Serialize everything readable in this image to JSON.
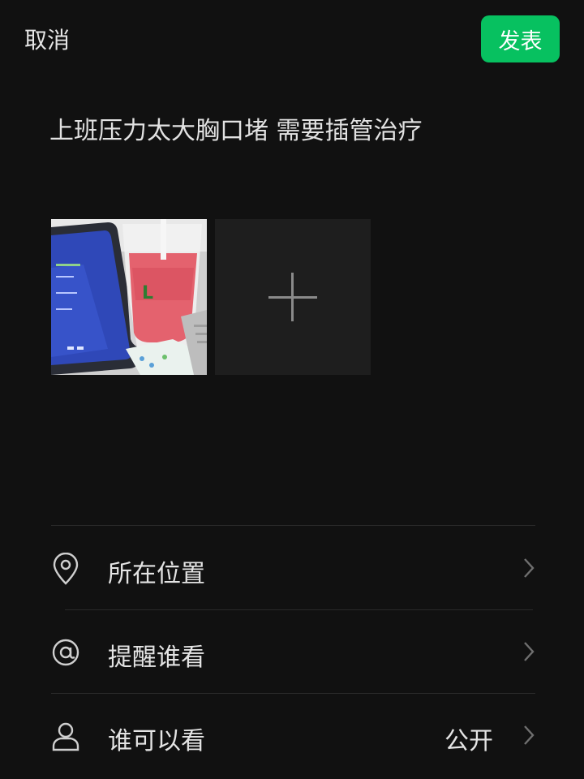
{
  "header": {
    "cancel_label": "取消",
    "publish_label": "发表",
    "publish_color": "#07c160"
  },
  "post": {
    "text": "上班压力太大胸口堵 需要插管治疗"
  },
  "media": {
    "photo_icon": "photo-thumbnail",
    "add_icon": "plus-icon"
  },
  "options": [
    {
      "label": "所在位置",
      "icon": "location-pin-icon",
      "value": ""
    },
    {
      "label": "提醒谁看",
      "icon": "at-icon",
      "value": ""
    },
    {
      "label": "谁可以看",
      "icon": "person-icon",
      "value": "公开"
    }
  ]
}
